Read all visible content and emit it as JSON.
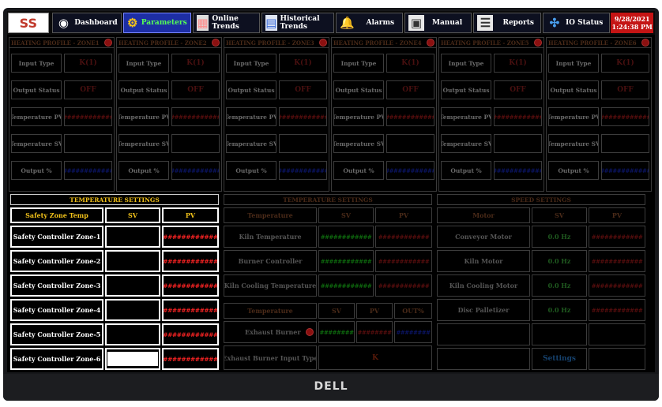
{
  "brand": "DELL",
  "nav": {
    "logo": "SS",
    "items": [
      {
        "label": "Dashboard",
        "icon": "dashboard-icon",
        "glyph": "◉"
      },
      {
        "label": "Parameters",
        "icon": "parameters-icon",
        "glyph": "⚙"
      },
      {
        "label": "Online Trends",
        "icon": "online-trends-icon",
        "glyph": "▦"
      },
      {
        "label": "Historical Trends",
        "icon": "historical-trends-icon",
        "glyph": "▤"
      },
      {
        "label": "Alarms",
        "icon": "bell-icon",
        "glyph": "🔔"
      },
      {
        "label": "Manual",
        "icon": "manual-icon",
        "glyph": "▣"
      },
      {
        "label": "Reports",
        "icon": "reports-icon",
        "glyph": "☰"
      },
      {
        "label": "IO Status",
        "icon": "io-status-icon",
        "glyph": "✣"
      }
    ],
    "active": "Parameters",
    "date": "9/28/2021",
    "time": "1:24:38 PM"
  },
  "zones": [
    {
      "title": "HEATING PROFILE - ZONE1",
      "input_type_label": "Input Type",
      "input_type": "K(1)",
      "output_status_label": "Output Status",
      "output_status": "OFF",
      "temp_pv_label": "Temperature PV",
      "temp_pv": "############",
      "temp_sv_label": "Temperature SV",
      "temp_sv": "",
      "output_pct_label": "Output %",
      "output_pct": "############"
    },
    {
      "title": "HEATING PROFILE - ZONE2",
      "input_type_label": "Input Type",
      "input_type": "K(1)",
      "output_status_label": "Output Status",
      "output_status": "OFF",
      "temp_pv_label": "Temperature PV",
      "temp_pv": "############",
      "temp_sv_label": "Temperature SV",
      "temp_sv": "",
      "output_pct_label": "Output %",
      "output_pct": "############"
    },
    {
      "title": "HEATING PROFILE - ZONE3",
      "input_type_label": "Input Type",
      "input_type": "K(1)",
      "output_status_label": "Output Status",
      "output_status": "OFF",
      "temp_pv_label": "Temperature PV",
      "temp_pv": "############",
      "temp_sv_label": "Temperature SV",
      "temp_sv": "",
      "output_pct_label": "Output %",
      "output_pct": "############"
    },
    {
      "title": "HEATING PROFILE - ZONE4",
      "input_type_label": "Input Type",
      "input_type": "K(1)",
      "output_status_label": "Output Status",
      "output_status": "OFF",
      "temp_pv_label": "Temperature PV",
      "temp_pv": "############",
      "temp_sv_label": "Temperature SV",
      "temp_sv": "",
      "output_pct_label": "Output %",
      "output_pct": "############"
    },
    {
      "title": "HEATING PROFILE - ZONE5",
      "input_type_label": "Input Type",
      "input_type": "K(1)",
      "output_status_label": "Output Status",
      "output_status": "OFF",
      "temp_pv_label": "Temperature PV",
      "temp_pv": "############",
      "temp_sv_label": "Temperature SV",
      "temp_sv": "",
      "output_pct_label": "Output %",
      "output_pct": "############"
    },
    {
      "title": "HEATING PROFILE - ZONE6",
      "input_type_label": "Input Type",
      "input_type": "K(1)",
      "output_status_label": "Output Status",
      "output_status": "OFF",
      "temp_pv_label": "Temperature PV",
      "temp_pv": "############",
      "temp_sv_label": "Temperature SV",
      "temp_sv": "",
      "output_pct_label": "Output %",
      "output_pct": "############"
    }
  ],
  "temperature_settings_active": {
    "title": "TEMPERATURE SETTINGS",
    "headers": [
      "Safety Zone Temp",
      "SV",
      "PV"
    ],
    "rows": [
      {
        "name": "Safety Controller Zone-1",
        "sv": "",
        "pv": "############"
      },
      {
        "name": "Safety Controller Zone-2",
        "sv": "",
        "pv": "############"
      },
      {
        "name": "Safety Controller Zone-3",
        "sv": "",
        "pv": "############"
      },
      {
        "name": "Safety Controller Zone-4",
        "sv": "",
        "pv": "############"
      },
      {
        "name": "Safety Controller Zone-5",
        "sv": "",
        "pv": "############"
      },
      {
        "name": "Safety Controller Zone-6",
        "sv": "",
        "pv": "############"
      }
    ]
  },
  "temperature_settings_kiln": {
    "title": "TEMPERATURE SETTINGS",
    "headers": [
      "Temperature",
      "SV",
      "PV"
    ],
    "rows": [
      {
        "name": "Kiln Temperature",
        "sv": "############",
        "pv": "############"
      },
      {
        "name": "Burner Controller",
        "sv": "############",
        "pv": "############"
      },
      {
        "name": "Kiln Cooling Temperature",
        "sv": "############",
        "pv": "############"
      }
    ],
    "exhaust_headers": [
      "Temperature",
      "SV",
      "PV",
      "OUT%"
    ],
    "exhaust_burner": {
      "name": "Exhaust Burner",
      "sv": "########",
      "pv": "########",
      "out": "########"
    },
    "exhaust_input_type": {
      "name": "Exhaust Burner Input Type",
      "value": "K"
    }
  },
  "speed_settings": {
    "title": "SPEED SETTINGS",
    "headers": [
      "Motor",
      "SV",
      "PV"
    ],
    "rows": [
      {
        "name": "Conveyor Motor",
        "sv": "0.0 Hz",
        "pv": "############"
      },
      {
        "name": "Kiln Motor",
        "sv": "0.0 Hz",
        "pv": "############"
      },
      {
        "name": "Kiln Cooling Motor",
        "sv": "0.0 Hz",
        "pv": "############"
      },
      {
        "name": "Disc Palletizer",
        "sv": "0.0 Hz",
        "pv": "############"
      }
    ],
    "settings_link": "Settings"
  }
}
